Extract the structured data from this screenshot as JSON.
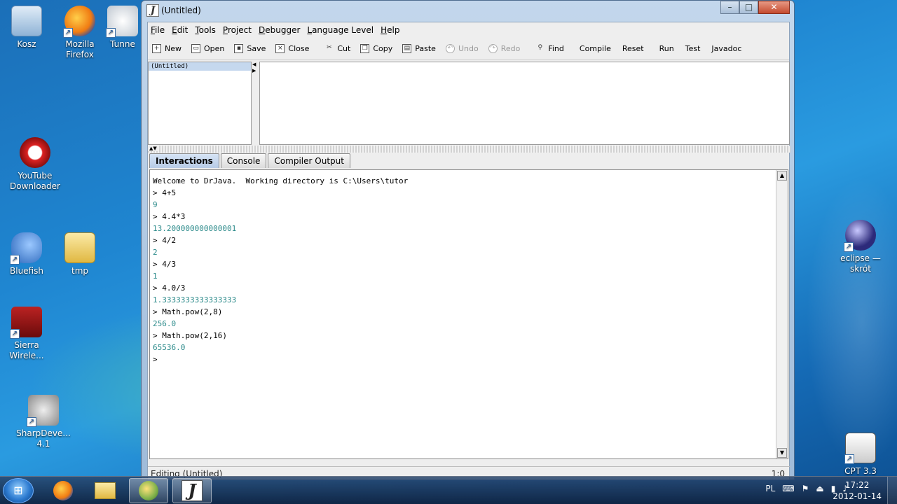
{
  "desktop": {
    "icons": [
      {
        "label": "Kosz",
        "icon": "recycle-bin-icon"
      },
      {
        "label": "Mozilla Firefox",
        "icon": "firefox-icon"
      },
      {
        "label": "Tunne",
        "icon": "tunnel-icon"
      },
      {
        "label": "YouTube Downloader",
        "icon": "youtube-downloader-icon"
      },
      {
        "label": "Bluefish",
        "icon": "bluefish-icon"
      },
      {
        "label": "tmp",
        "icon": "folder-icon"
      },
      {
        "label": "Sierra Wirele...",
        "icon": "sierra-wireless-icon"
      },
      {
        "label": "SharpDeve... 4.1",
        "icon": "sharpdevelop-icon"
      },
      {
        "label": "eclipse — skrót",
        "icon": "eclipse-icon"
      },
      {
        "label": "CPT 3.3",
        "icon": "cpt-icon"
      }
    ]
  },
  "window": {
    "title": "(Untitled)",
    "controls": {
      "minimize": "–",
      "maximize": "□",
      "close": "✕"
    },
    "menu": [
      "File",
      "Edit",
      "Tools",
      "Project",
      "Debugger",
      "Language Level",
      "Help"
    ],
    "toolbar": [
      {
        "label": "New",
        "icon": "new-file-icon",
        "enabled": true
      },
      {
        "label": "Open",
        "icon": "open-file-icon",
        "enabled": true
      },
      {
        "label": "Save",
        "icon": "save-icon",
        "enabled": true
      },
      {
        "label": "Close",
        "icon": "close-file-icon",
        "enabled": true
      },
      {
        "label": "Cut",
        "icon": "scissors-icon",
        "enabled": true
      },
      {
        "label": "Copy",
        "icon": "copy-icon",
        "enabled": true
      },
      {
        "label": "Paste",
        "icon": "paste-icon",
        "enabled": true
      },
      {
        "label": "Undo",
        "icon": "undo-icon",
        "enabled": false
      },
      {
        "label": "Redo",
        "icon": "redo-icon",
        "enabled": false
      },
      {
        "label": "Find",
        "icon": "binoculars-icon",
        "enabled": true
      },
      {
        "label": "Compile",
        "icon": "",
        "enabled": true
      },
      {
        "label": "Reset",
        "icon": "",
        "enabled": true
      },
      {
        "label": "Run",
        "icon": "",
        "enabled": true
      },
      {
        "label": "Test",
        "icon": "",
        "enabled": true
      },
      {
        "label": "Javadoc",
        "icon": "",
        "enabled": true
      }
    ],
    "documents": [
      "(Untitled)"
    ],
    "tabs": [
      {
        "label": "Interactions",
        "active": true
      },
      {
        "label": "Console",
        "active": false
      },
      {
        "label": "Compiler Output",
        "active": false
      }
    ],
    "interactions": [
      {
        "kind": "black",
        "text": "Welcome to DrJava.  Working directory is C:\\Users\\tutor"
      },
      {
        "kind": "prompt",
        "text": "> 4+5"
      },
      {
        "kind": "result",
        "text": "9"
      },
      {
        "kind": "prompt",
        "text": "> 4.4*3"
      },
      {
        "kind": "result",
        "text": "13.200000000000001"
      },
      {
        "kind": "prompt",
        "text": "> 4/2"
      },
      {
        "kind": "result",
        "text": "2"
      },
      {
        "kind": "prompt",
        "text": "> 4/3"
      },
      {
        "kind": "result",
        "text": "1"
      },
      {
        "kind": "prompt",
        "text": "> 4.0/3"
      },
      {
        "kind": "result",
        "text": "1.3333333333333333"
      },
      {
        "kind": "prompt",
        "text": "> Math.pow(2,8)"
      },
      {
        "kind": "result",
        "text": "256.0"
      },
      {
        "kind": "prompt",
        "text": "> Math.pow(2,16)"
      },
      {
        "kind": "result",
        "text": "65536.0"
      },
      {
        "kind": "prompt",
        "text": ">"
      }
    ],
    "status": {
      "left": "Editing (Untitled)",
      "right": "1:0"
    }
  },
  "taskbar": {
    "start_icon": "windows-start-icon",
    "apps": [
      {
        "icon": "firefox-icon",
        "active": false
      },
      {
        "icon": "explorer-folder-icon",
        "active": false
      },
      {
        "icon": "pidgin-icon",
        "active": true
      },
      {
        "icon": "drjava-icon",
        "active": true
      }
    ],
    "language": "PL",
    "time": "17:22",
    "date": "2012-01-14"
  }
}
